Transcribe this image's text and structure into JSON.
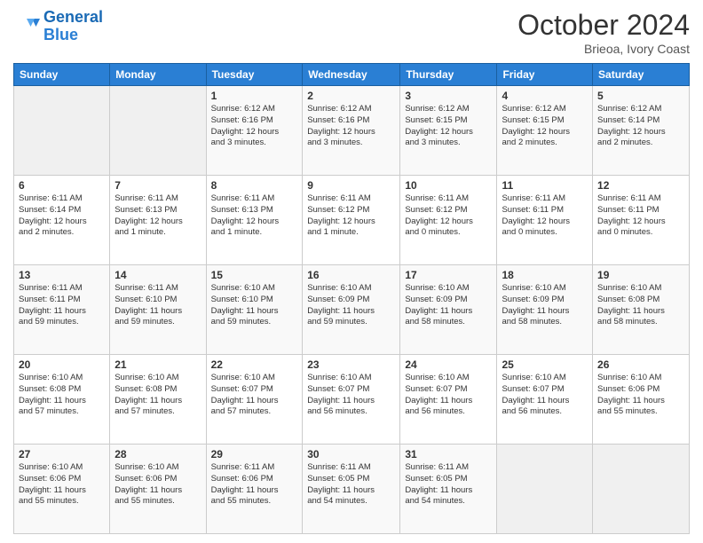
{
  "header": {
    "logo_line1": "General",
    "logo_line2": "Blue",
    "month_year": "October 2024",
    "location": "Brieoa, Ivory Coast"
  },
  "days_of_week": [
    "Sunday",
    "Monday",
    "Tuesday",
    "Wednesday",
    "Thursday",
    "Friday",
    "Saturday"
  ],
  "weeks": [
    [
      {
        "day": "",
        "info": ""
      },
      {
        "day": "",
        "info": ""
      },
      {
        "day": "1",
        "info": "Sunrise: 6:12 AM\nSunset: 6:16 PM\nDaylight: 12 hours\nand 3 minutes."
      },
      {
        "day": "2",
        "info": "Sunrise: 6:12 AM\nSunset: 6:16 PM\nDaylight: 12 hours\nand 3 minutes."
      },
      {
        "day": "3",
        "info": "Sunrise: 6:12 AM\nSunset: 6:15 PM\nDaylight: 12 hours\nand 3 minutes."
      },
      {
        "day": "4",
        "info": "Sunrise: 6:12 AM\nSunset: 6:15 PM\nDaylight: 12 hours\nand 2 minutes."
      },
      {
        "day": "5",
        "info": "Sunrise: 6:12 AM\nSunset: 6:14 PM\nDaylight: 12 hours\nand 2 minutes."
      }
    ],
    [
      {
        "day": "6",
        "info": "Sunrise: 6:11 AM\nSunset: 6:14 PM\nDaylight: 12 hours\nand 2 minutes."
      },
      {
        "day": "7",
        "info": "Sunrise: 6:11 AM\nSunset: 6:13 PM\nDaylight: 12 hours\nand 1 minute."
      },
      {
        "day": "8",
        "info": "Sunrise: 6:11 AM\nSunset: 6:13 PM\nDaylight: 12 hours\nand 1 minute."
      },
      {
        "day": "9",
        "info": "Sunrise: 6:11 AM\nSunset: 6:12 PM\nDaylight: 12 hours\nand 1 minute."
      },
      {
        "day": "10",
        "info": "Sunrise: 6:11 AM\nSunset: 6:12 PM\nDaylight: 12 hours\nand 0 minutes."
      },
      {
        "day": "11",
        "info": "Sunrise: 6:11 AM\nSunset: 6:11 PM\nDaylight: 12 hours\nand 0 minutes."
      },
      {
        "day": "12",
        "info": "Sunrise: 6:11 AM\nSunset: 6:11 PM\nDaylight: 12 hours\nand 0 minutes."
      }
    ],
    [
      {
        "day": "13",
        "info": "Sunrise: 6:11 AM\nSunset: 6:11 PM\nDaylight: 11 hours\nand 59 minutes."
      },
      {
        "day": "14",
        "info": "Sunrise: 6:11 AM\nSunset: 6:10 PM\nDaylight: 11 hours\nand 59 minutes."
      },
      {
        "day": "15",
        "info": "Sunrise: 6:10 AM\nSunset: 6:10 PM\nDaylight: 11 hours\nand 59 minutes."
      },
      {
        "day": "16",
        "info": "Sunrise: 6:10 AM\nSunset: 6:09 PM\nDaylight: 11 hours\nand 59 minutes."
      },
      {
        "day": "17",
        "info": "Sunrise: 6:10 AM\nSunset: 6:09 PM\nDaylight: 11 hours\nand 58 minutes."
      },
      {
        "day": "18",
        "info": "Sunrise: 6:10 AM\nSunset: 6:09 PM\nDaylight: 11 hours\nand 58 minutes."
      },
      {
        "day": "19",
        "info": "Sunrise: 6:10 AM\nSunset: 6:08 PM\nDaylight: 11 hours\nand 58 minutes."
      }
    ],
    [
      {
        "day": "20",
        "info": "Sunrise: 6:10 AM\nSunset: 6:08 PM\nDaylight: 11 hours\nand 57 minutes."
      },
      {
        "day": "21",
        "info": "Sunrise: 6:10 AM\nSunset: 6:08 PM\nDaylight: 11 hours\nand 57 minutes."
      },
      {
        "day": "22",
        "info": "Sunrise: 6:10 AM\nSunset: 6:07 PM\nDaylight: 11 hours\nand 57 minutes."
      },
      {
        "day": "23",
        "info": "Sunrise: 6:10 AM\nSunset: 6:07 PM\nDaylight: 11 hours\nand 56 minutes."
      },
      {
        "day": "24",
        "info": "Sunrise: 6:10 AM\nSunset: 6:07 PM\nDaylight: 11 hours\nand 56 minutes."
      },
      {
        "day": "25",
        "info": "Sunrise: 6:10 AM\nSunset: 6:07 PM\nDaylight: 11 hours\nand 56 minutes."
      },
      {
        "day": "26",
        "info": "Sunrise: 6:10 AM\nSunset: 6:06 PM\nDaylight: 11 hours\nand 55 minutes."
      }
    ],
    [
      {
        "day": "27",
        "info": "Sunrise: 6:10 AM\nSunset: 6:06 PM\nDaylight: 11 hours\nand 55 minutes."
      },
      {
        "day": "28",
        "info": "Sunrise: 6:10 AM\nSunset: 6:06 PM\nDaylight: 11 hours\nand 55 minutes."
      },
      {
        "day": "29",
        "info": "Sunrise: 6:11 AM\nSunset: 6:06 PM\nDaylight: 11 hours\nand 55 minutes."
      },
      {
        "day": "30",
        "info": "Sunrise: 6:11 AM\nSunset: 6:05 PM\nDaylight: 11 hours\nand 54 minutes."
      },
      {
        "day": "31",
        "info": "Sunrise: 6:11 AM\nSunset: 6:05 PM\nDaylight: 11 hours\nand 54 minutes."
      },
      {
        "day": "",
        "info": ""
      },
      {
        "day": "",
        "info": ""
      }
    ]
  ]
}
